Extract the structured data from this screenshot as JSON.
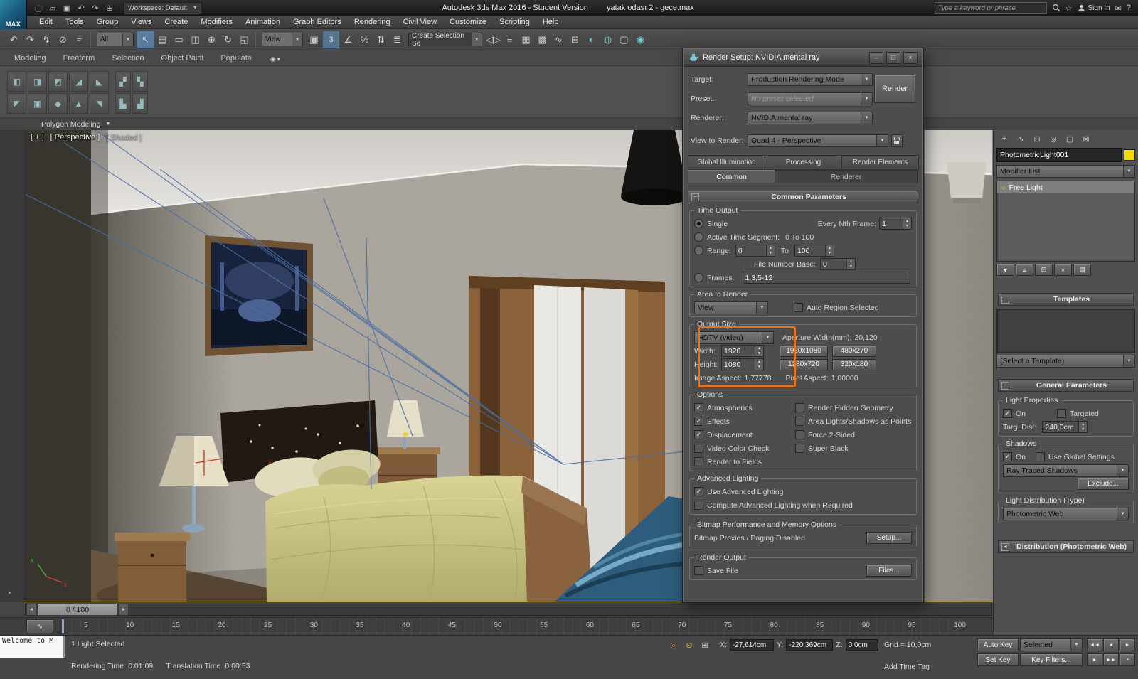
{
  "colors": {
    "accent_orange": "#e8741e",
    "light_swatch_yellow": "#f2da00",
    "selection_wire_blue": "#4a6fa5"
  },
  "titlebar": {
    "logo_text": "MAX",
    "quick_icons": [
      {
        "name": "new-scene-icon",
        "glyph": "▢"
      },
      {
        "name": "open-file-icon",
        "glyph": "▱"
      },
      {
        "name": "save-file-icon",
        "glyph": "▣"
      },
      {
        "name": "undo-icon",
        "glyph": "↶"
      },
      {
        "name": "redo-icon",
        "glyph": "↷"
      },
      {
        "name": "project-folder-icon",
        "glyph": "⊞"
      }
    ],
    "workspace_label": "Workspace: Default",
    "app_title": "Autodesk 3ds Max 2016 - Student Version",
    "document_title": "yatak odası 2 - gece.max",
    "search_placeholder": "Type a keyword or phrase",
    "signin_label": "Sign In",
    "right_icons": [
      {
        "name": "favorites-star-icon",
        "glyph": "☆"
      },
      {
        "name": "communication-center-icon",
        "glyph": "✉"
      },
      {
        "name": "help-icon",
        "glyph": "?"
      }
    ]
  },
  "menubar": {
    "items": [
      "Edit",
      "Tools",
      "Group",
      "Views",
      "Create",
      "Modifiers",
      "Animation",
      "Graph Editors",
      "Rendering",
      "Civil View",
      "Customize",
      "Scripting",
      "Help"
    ]
  },
  "toolbar": {
    "icons_a": [
      {
        "name": "undo-icon",
        "glyph": "↶"
      },
      {
        "name": "redo-icon",
        "glyph": "↷"
      },
      {
        "name": "select-and-link-icon",
        "glyph": "↯"
      },
      {
        "name": "unlink-selection-icon",
        "glyph": "⊘"
      },
      {
        "name": "bind-to-space-warp-icon",
        "glyph": "≈"
      }
    ],
    "filter_value": "All",
    "icons_b": [
      {
        "name": "select-object-icon",
        "glyph": "↖"
      },
      {
        "name": "select-by-name-icon",
        "glyph": "▤"
      },
      {
        "name": "rectangular-selection-region-icon",
        "glyph": "▭"
      },
      {
        "name": "window-crossing-icon",
        "glyph": "◫"
      },
      {
        "name": "select-and-move-icon",
        "glyph": "⊕"
      },
      {
        "name": "select-and-rotate-icon",
        "glyph": "↻"
      },
      {
        "name": "select-and-scale-icon",
        "glyph": "◱"
      }
    ],
    "coord_value": "View",
    "icons_c": [
      {
        "name": "use-pivot-point-icon",
        "glyph": "▣"
      },
      {
        "name": "snap-toggle-3d-icon",
        "glyph": "3"
      },
      {
        "name": "angle-snap-icon",
        "glyph": "∠"
      },
      {
        "name": "percent-snap-icon",
        "glyph": "%"
      },
      {
        "name": "spinner-snap-icon",
        "glyph": "⇅"
      },
      {
        "name": "named-selection-sets-icon",
        "glyph": "≣"
      }
    ],
    "selection_set_value": "Create Selection Se",
    "icons_d": [
      {
        "name": "mirror-icon",
        "glyph": "◁▷"
      },
      {
        "name": "align-icon",
        "glyph": "≡"
      },
      {
        "name": "layer-manager-icon",
        "glyph": "▦"
      },
      {
        "name": "ribbon-toggle-icon",
        "glyph": "▩"
      },
      {
        "name": "curve-editor-icon",
        "glyph": "∿"
      },
      {
        "name": "schematic-view-icon",
        "glyph": "⊞"
      },
      {
        "name": "material-editor-icon",
        "glyph": "◐"
      },
      {
        "name": "render-setup-icon",
        "glyph": "◍"
      },
      {
        "name": "rendered-frame-window-icon",
        "glyph": "▢"
      },
      {
        "name": "render-production-icon",
        "glyph": "◉"
      }
    ]
  },
  "ribbon": {
    "tabs": [
      {
        "name": "tab-modeling",
        "label": "Modeling",
        "active": "1"
      },
      {
        "name": "tab-freeform",
        "label": "Freeform",
        "active": ""
      },
      {
        "name": "tab-selection",
        "label": "Selection",
        "active": ""
      },
      {
        "name": "tab-object-paint",
        "label": "Object Paint",
        "active": ""
      },
      {
        "name": "tab-populate",
        "label": "Populate",
        "active": ""
      }
    ],
    "tools_row1": [
      {
        "name": "modeling-tool-button",
        "glyph": "◧"
      },
      {
        "name": "modeling-tool-button",
        "glyph": "◨"
      },
      {
        "name": "modeling-tool-button",
        "glyph": "◩"
      },
      {
        "name": "modeling-tool-button",
        "glyph": "◢"
      },
      {
        "name": "modeling-tool-button",
        "glyph": "◣"
      }
    ],
    "tools_row2": [
      {
        "name": "modeling-tool-button",
        "glyph": "◤"
      },
      {
        "name": "modeling-tool-button",
        "glyph": "▣"
      },
      {
        "name": "modeling-tool-button",
        "glyph": "◆"
      },
      {
        "name": "modeling-tool-button",
        "glyph": "▲"
      },
      {
        "name": "modeling-tool-button",
        "glyph": "◥"
      }
    ],
    "tools_side": [
      {
        "name": "modeling-tool-button",
        "glyph": "▞"
      },
      {
        "name": "modeling-tool-button",
        "glyph": "▚"
      },
      {
        "name": "modeling-tool-button",
        "glyph": "▙"
      },
      {
        "name": "modeling-tool-button",
        "glyph": "▟"
      }
    ],
    "panel_label": "Polygon Modeling"
  },
  "viewport": {
    "menu_plus": "[ + ]",
    "menu_view": "[ Perspective ]",
    "menu_shading": "[ Shaded ]"
  },
  "render_dialog": {
    "title": "Render Setup: NVIDIA mental ray",
    "window_buttons": [
      {
        "name": "minimize-button",
        "glyph": "–"
      },
      {
        "name": "maximize-button",
        "glyph": "□"
      },
      {
        "name": "close-button",
        "glyph": "×"
      }
    ],
    "target_label": "Target:",
    "target_value": "Production Rendering Mode",
    "preset_label": "Preset:",
    "preset_value": "No preset selected",
    "renderer_label": "Renderer:",
    "renderer_value": "NVIDIA mental ray",
    "view_label": "View to Render:",
    "view_value": "Quad 4 - Perspective",
    "render_button": "Render",
    "tabs_top": [
      {
        "name": "tab-global-illumination",
        "label": "Global Illumination"
      },
      {
        "name": "tab-processing",
        "label": "Processing"
      },
      {
        "name": "tab-render-elements",
        "label": "Render Elements"
      }
    ],
    "tab_common": "Common",
    "tab_renderer": "Renderer",
    "rollout_label": "Common Parameters",
    "to_group_label": "Time Output",
    "to_single_label": "Single",
    "to_every_label": "Every Nth Frame:",
    "to_every_value": "1",
    "to_active_label": "Active Time Segment:",
    "to_active_value": "0 To 100",
    "to_range_label": "Range:",
    "to_range_from": "0",
    "to_to_label": "To",
    "to_range_to": "100",
    "to_file_label": "File Number Base:",
    "to_file_value": "0",
    "to_frames_label": "Frames",
    "to_frames_value": "1,3,5-12",
    "ar_group_label": "Area to Render",
    "ar_view_value": "View",
    "ar_auto_label": "Auto Region Selected",
    "ar_auto_check": "",
    "os_group_label": "Output Size",
    "os_preset_value": "HDTV (video)",
    "os_aperture_label": "Aperture Width(mm):",
    "os_aperture_value": "20,120",
    "os_width_label": "Width:",
    "os_width_value": "1920",
    "os_height_label": "Height:",
    "os_height_value": "1080",
    "os_res_buttons": [
      "1920x1080",
      "480x270",
      "1280x720",
      "320x180"
    ],
    "os_image_label": "Image Aspect:",
    "os_image_value": "1,77778",
    "os_pixel_label": "Pixel Aspect:",
    "os_pixel_value": "1,00000",
    "opt_group_label": "Options",
    "opt_left": [
      {
        "name": "atmospherics-checkbox",
        "label": "Atmospherics",
        "check": "✓"
      },
      {
        "name": "effects-checkbox",
        "label": "Effects",
        "check": "✓"
      },
      {
        "name": "displacement-checkbox",
        "label": "Displacement",
        "check": "✓"
      },
      {
        "name": "video-color-check-checkbox",
        "label": "Video Color Check",
        "check": ""
      },
      {
        "name": "render-to-fields-checkbox",
        "label": "Render to Fields",
        "check": ""
      }
    ],
    "opt_right": [
      {
        "name": "render-hidden-geometry-checkbox",
        "label": "Render Hidden Geometry",
        "check": ""
      },
      {
        "name": "area-lights-shadows-checkbox",
        "label": "Area Lights/Shadows as Points",
        "check": ""
      },
      {
        "name": "force-2-sided-checkbox",
        "label": "Force 2-Sided",
        "check": ""
      },
      {
        "name": "super-black-checkbox",
        "label": "Super Black",
        "check": ""
      }
    ],
    "al_group_label": "Advanced Lighting",
    "al_items": [
      {
        "name": "use-advanced-lighting-checkbox",
        "label": "Use Advanced Lighting",
        "check": "✓"
      },
      {
        "name": "compute-advanced-lighting-checkbox",
        "label": "Compute Advanced Lighting when Required",
        "check": ""
      }
    ],
    "bm_group_label": "Bitmap Performance and Memory Options",
    "bm_status": "Bitmap Proxies / Paging Disabled",
    "bm_setup_button": "Setup...",
    "ro_group_label": "Render Output",
    "ro_save_label": "Save File",
    "ro_save_check": "",
    "ro_files_button": "Files..."
  },
  "command_panel": {
    "tabs": [
      {
        "name": "create-tab-icon",
        "glyph": "+",
        "active": ""
      },
      {
        "name": "modify-tab-icon",
        "glyph": "∿",
        "active": "1"
      },
      {
        "name": "hierarchy-tab-icon",
        "glyph": "⊟",
        "active": ""
      },
      {
        "name": "motion-tab-icon",
        "glyph": "◎",
        "active": ""
      },
      {
        "name": "display-tab-icon",
        "glyph": "▢",
        "active": ""
      },
      {
        "name": "utilities-tab-icon",
        "glyph": "⊠",
        "active": ""
      }
    ],
    "object_name": "PhotometricLight001",
    "modifier_list_label": "Modifier List",
    "stack_items": [
      {
        "label": "Free Light"
      }
    ],
    "stack_buttons": [
      {
        "name": "pin-stack-icon",
        "glyph": "▼"
      },
      {
        "name": "show-end-result-icon",
        "glyph": "≡"
      },
      {
        "name": "make-unique-icon",
        "glyph": "⊡"
      },
      {
        "name": "remove-modifier-icon",
        "glyph": "×"
      },
      {
        "name": "configure-modifier-sets-icon",
        "glyph": "▤"
      }
    ],
    "templates_header": "Templates",
    "templates_select_value": "(Select a Template)",
    "general_header": "General Parameters",
    "lp_group_label": "Light Properties",
    "lp_on_label": "On",
    "lp_on_check": "✓",
    "lp_targeted_label": "Targeted",
    "lp_targeted_check": "",
    "lp_dist_label": "Targ. Dist:",
    "lp_dist_value": "240,0cm",
    "sh_group_label": "Shadows",
    "sh_on_label": "On",
    "sh_on_check": "✓",
    "sh_global_label": "Use Global Settings",
    "sh_global_check": "",
    "sh_type_value": "Ray Traced Shadows",
    "sh_exclude_button": "Exclude...",
    "ld_group_label": "Light Distribution (Type)",
    "ld_value": "Photometric Web",
    "distribution_header": "Distribution (Photometric Web)"
  },
  "timeline": {
    "prev_glyph": "◄",
    "next_glyph": "►",
    "slider_value": "0 / 100",
    "curve_editor_glyph": "∿",
    "layout_arrow_glyph": "▸",
    "ticks": [
      "5",
      "10",
      "15",
      "20",
      "25",
      "30",
      "35",
      "40",
      "45",
      "50",
      "55",
      "60",
      "65",
      "70",
      "75",
      "80",
      "85",
      "90",
      "95",
      "100"
    ]
  },
  "statusbar": {
    "prompt": "1 Light Selected",
    "listener_text": "Welcome to M",
    "rendering_time_label": "Rendering Time",
    "rendering_time_value": "0:01:09",
    "translation_time_label": "Translation Time",
    "translation_time_value": "0:00:53",
    "status_icons": [
      {
        "name": "isolate-selection-icon",
        "glyph": "◎"
      },
      {
        "name": "selection-lock-icon",
        "glyph": "⊙"
      },
      {
        "name": "offset-mode-icon",
        "glyph": "⊞"
      }
    ],
    "x_label": "X:",
    "x_value": "-27,614cm",
    "y_label": "Y:",
    "y_value": "-220,369cm",
    "z_label": "Z:",
    "z_value": "0,0cm",
    "grid_label": "Grid = 10,0cm",
    "add_time_tag_label": "Add Time Tag",
    "auto_key_label": "Auto Key",
    "selected_value": "Selected",
    "set_key_label": "Set Key",
    "key_filters_label": "Key Filters...",
    "transport_row1": [
      {
        "name": "go-to-start-icon",
        "glyph": "◄◄"
      },
      {
        "name": "previous-frame-icon",
        "glyph": "◄"
      },
      {
        "name": "play-animation-icon",
        "glyph": "►"
      }
    ],
    "transport_row2": [
      {
        "name": "next-frame-icon",
        "glyph": "►"
      },
      {
        "name": "go-to-end-icon",
        "glyph": "►►"
      },
      {
        "name": "time-configuration-icon",
        "glyph": "◔"
      }
    ]
  }
}
